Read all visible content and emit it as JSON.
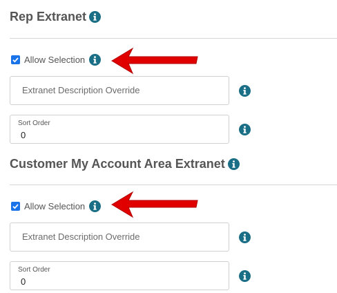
{
  "rep_section": {
    "title": "Rep Extranet",
    "allow_selection_label": "Allow Selection",
    "allow_selection_checked": true,
    "description_placeholder": "Extranet Description Override",
    "sort_order_label": "Sort Order",
    "sort_order_value": "0"
  },
  "customer_section": {
    "title": "Customer My Account Area Extranet",
    "allow_selection_label": "Allow Selection",
    "allow_selection_checked": true,
    "description_placeholder": "Extranet Description Override",
    "sort_order_label": "Sort Order",
    "sort_order_value": "0"
  },
  "icons": {
    "info": "info-circle-icon",
    "checkbox": "checkmark-icon",
    "annotation_arrow": "red-arrow-left-icon"
  },
  "colors": {
    "accent": "#1a6e85",
    "checkbox": "#1a73e8",
    "arrow": "#e00000",
    "text": "#555555"
  }
}
